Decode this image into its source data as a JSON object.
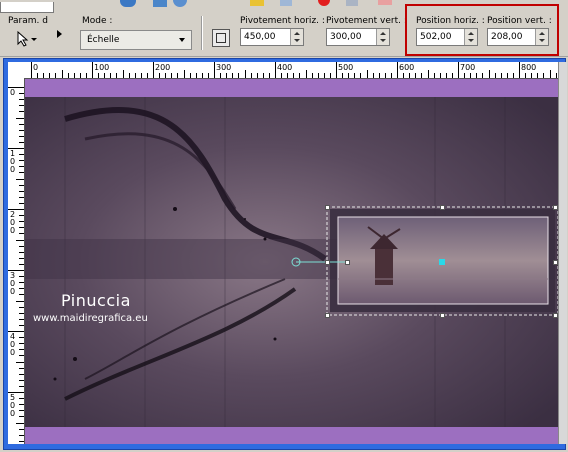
{
  "toolbar": {
    "preset_label": "Param. d",
    "mode_label": "Mode :",
    "mode_value": "Échelle",
    "pivot_h_label": "Pivotement horiz. :",
    "pivot_h_value": "450,00",
    "pivot_v_label": "Pivotement vert. :",
    "pivot_v_value": "300,00",
    "pos_h_label": "Position horiz. :",
    "pos_h_value": "502,00",
    "pos_v_label": "Position vert. :",
    "pos_v_value": "208,00",
    "highlight_color": "#c00000"
  },
  "ruler": {
    "h_labels": [
      "0",
      "100",
      "200",
      "300",
      "400",
      "500",
      "600",
      "700",
      "800"
    ],
    "v_labels": [
      "0",
      "100",
      "200",
      "300",
      "400",
      "500"
    ]
  },
  "canvas": {
    "watermark_name": "Pinuccia",
    "watermark_url": "www.maidiregrafica.eu",
    "band_color": "#9c6fc0",
    "bg_color": "#4a3a52"
  }
}
